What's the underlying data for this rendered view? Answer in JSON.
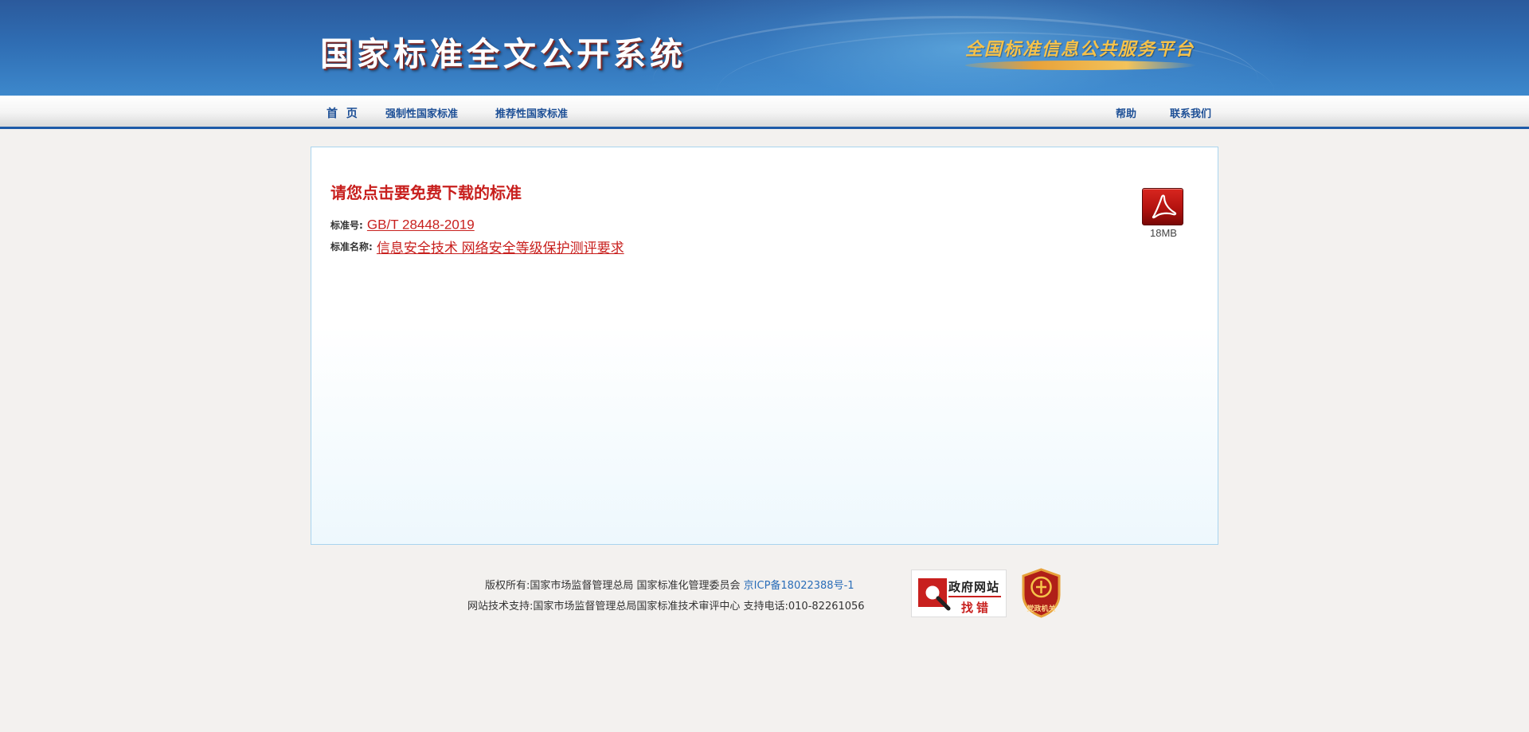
{
  "header": {
    "site_title": "国家标准全文公开系统",
    "slogan": "全国标准信息公共服务平台"
  },
  "nav": {
    "home": "首 页",
    "mandatory": "强制性国家标准",
    "recommended": "推荐性国家标准",
    "help": "帮助",
    "contact": "联系我们"
  },
  "main": {
    "prompt": "请您点击要免费下载的标准",
    "standard_no_label": "标准号:",
    "standard_no": "GB/T 28448-2019",
    "standard_name_label": "标准名称:",
    "standard_name": "信息安全技术 网络安全等级保护测评要求",
    "pdf_icon": "pdf-icon",
    "file_size": "18MB"
  },
  "footer": {
    "copyright": "版权所有:国家市场监督管理总局 国家标准化管理委员会 ",
    "icp": "京ICP备18022388号-1",
    "support": "网站技术支持:国家市场监督管理总局国家标准技术审评中心 支持电话:010-82261056",
    "gov_badge_line1": "政府网站",
    "gov_badge_line2": "找错",
    "party_badge": "党政机关"
  },
  "colors": {
    "accent_red": "#c8201e",
    "nav_blue": "#1d4f96",
    "link_blue": "#2a6db8"
  }
}
